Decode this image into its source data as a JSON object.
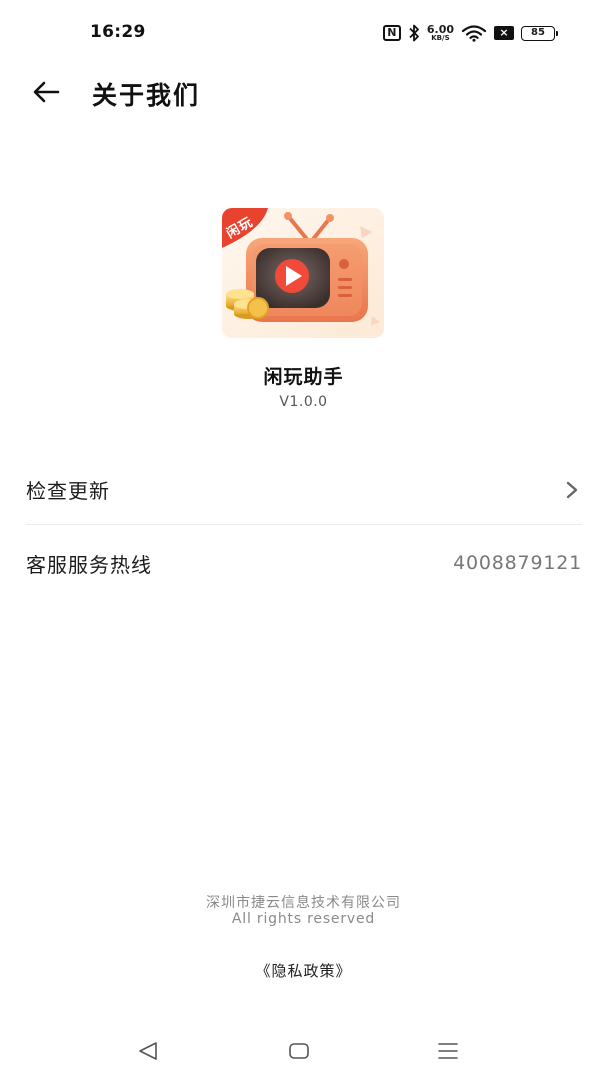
{
  "status_bar": {
    "time": "16:29",
    "net_speed_value": "6.00",
    "net_speed_unit": "KB/S",
    "sim_label": "×",
    "battery": "85"
  },
  "header": {
    "title": "关于我们",
    "back_icon": "arrow-left-icon"
  },
  "app": {
    "name": "闲玩助手",
    "version": "V1.0.0",
    "logo_badge": "闲玩"
  },
  "settings": {
    "items": [
      {
        "label": "检查更新",
        "icon": "chevron-right-icon"
      },
      {
        "label": "客服服务热线",
        "value": "4008879121"
      }
    ]
  },
  "footer": {
    "company": "深圳市捷云信息技术有限公司",
    "rights": "All rights reserved",
    "privacy": "《隐私政策》"
  },
  "colors": {
    "background": "#ffffff",
    "text_primary": "#1c1c1c",
    "text_secondary": "#777777",
    "logo_accent": "#e8432f"
  }
}
